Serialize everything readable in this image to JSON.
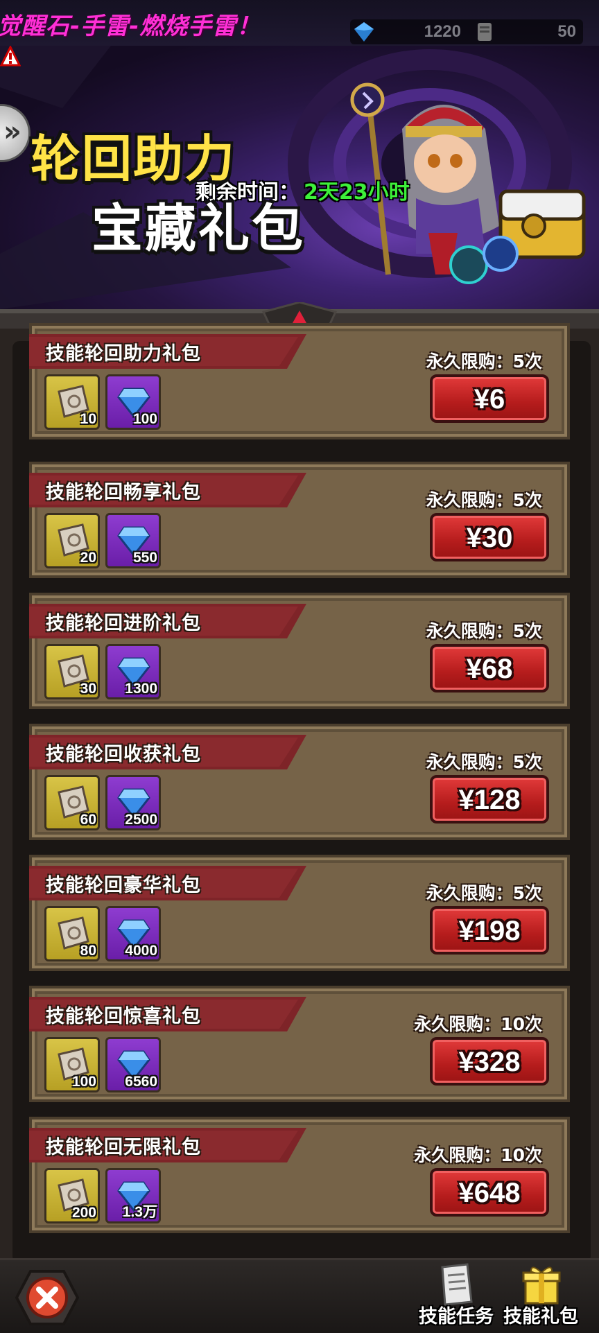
{
  "marquee": {
    "text": "觉醒石-手雷-燃烧手雷！"
  },
  "currency": {
    "gems": "1220",
    "scrolls": "50",
    "gem_icon": "diamond-icon",
    "scroll_icon": "scroll-icon"
  },
  "banner": {
    "title_line1": "轮回助力",
    "title_line2": "宝藏礼包",
    "timer_label": "剩余时间：",
    "timer_value": "2天23小时"
  },
  "packs": [
    {
      "title": "技能轮回助力礼包",
      "limit": "永久限购：5次",
      "scroll_qty": "10",
      "gem_qty": "100",
      "price": "¥6"
    },
    {
      "title": "技能轮回畅享礼包",
      "limit": "永久限购：5次",
      "scroll_qty": "20",
      "gem_qty": "550",
      "price": "¥30"
    },
    {
      "title": "技能轮回进阶礼包",
      "limit": "永久限购：5次",
      "scroll_qty": "30",
      "gem_qty": "1300",
      "price": "¥68"
    },
    {
      "title": "技能轮回收获礼包",
      "limit": "永久限购：5次",
      "scroll_qty": "60",
      "gem_qty": "2500",
      "price": "¥128"
    },
    {
      "title": "技能轮回豪华礼包",
      "limit": "永久限购：5次",
      "scroll_qty": "80",
      "gem_qty": "4000",
      "price": "¥198"
    },
    {
      "title": "技能轮回惊喜礼包",
      "limit": "永久限购：10次",
      "scroll_qty": "100",
      "gem_qty": "6560",
      "price": "¥328"
    },
    {
      "title": "技能轮回无限礼包",
      "limit": "永久限购：10次",
      "scroll_qty": "200",
      "gem_qty": "1.3万",
      "price": "¥648"
    }
  ],
  "bottom_nav": {
    "skill_tasks": "技能任务",
    "skill_packs": "技能礼包"
  },
  "colors": {
    "marquee": "#ff2fd6",
    "title_yellow": "#ffe347",
    "timer_green": "#3df03a",
    "price_red": "#c82424",
    "card_bg": "#766348",
    "ribbon": "#8a2a2e"
  }
}
